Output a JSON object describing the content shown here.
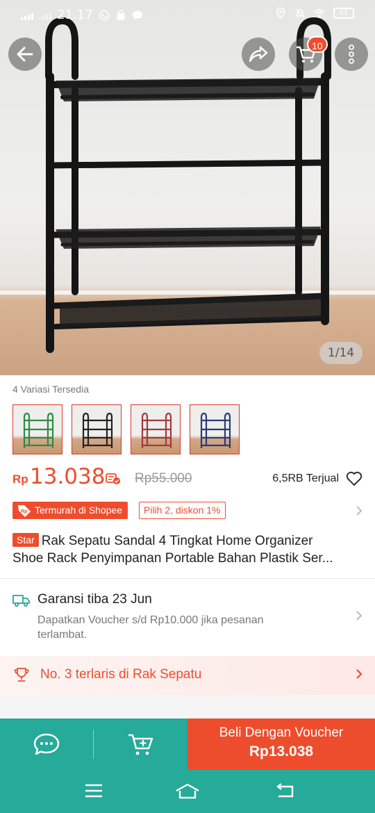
{
  "status_bar": {
    "time": "21.17",
    "battery": "61",
    "icons": [
      "signal-icon",
      "signal-icon",
      "whatsapp-icon",
      "shopping-bag-icon",
      "message-icon",
      "location-icon",
      "mute-icon",
      "wifi-icon",
      "battery-icon"
    ]
  },
  "header": {
    "back_icon": "arrow-left-icon",
    "share_icon": "share-icon",
    "cart_icon": "cart-icon",
    "cart_count": "10",
    "more_icon": "more-vertical-icon"
  },
  "gallery": {
    "counter": "1/14"
  },
  "variations": {
    "label": "4 Variasi Tersedia",
    "items": [
      {
        "name": "green",
        "color": "#2f8a45"
      },
      {
        "name": "black",
        "color": "#222222"
      },
      {
        "name": "red",
        "color": "#a23a3a"
      },
      {
        "name": "blue",
        "color": "#2a3b7a"
      }
    ]
  },
  "price": {
    "currency": "Rp",
    "current": "13.038",
    "original": "Rp55.000",
    "sold": "6,5RB Terjual"
  },
  "badges": {
    "cheapest": "Termurah di Shopee",
    "discount": "Pilih 2, diskon 1%"
  },
  "product": {
    "star_label": "Star",
    "title_line1": "Rak Sepatu Sandal 4 Tingkat Home Organizer",
    "title_line2": "Shoe Rack Penyimpanan Portable Bahan Plastik Ser..."
  },
  "guarantee": {
    "title": "Garansi tiba 23 Jun",
    "subtitle": "Dapatkan Voucher s/d Rp10.000 jika pesanan terlambat."
  },
  "ranking": {
    "text": "No. 3 terlaris di Rak Sepatu"
  },
  "bottom_bar": {
    "buy_label": "Beli Dengan Voucher",
    "buy_price": "Rp13.038"
  },
  "colors": {
    "brand_orange": "#ee4d2d",
    "teal": "#26aa99"
  }
}
